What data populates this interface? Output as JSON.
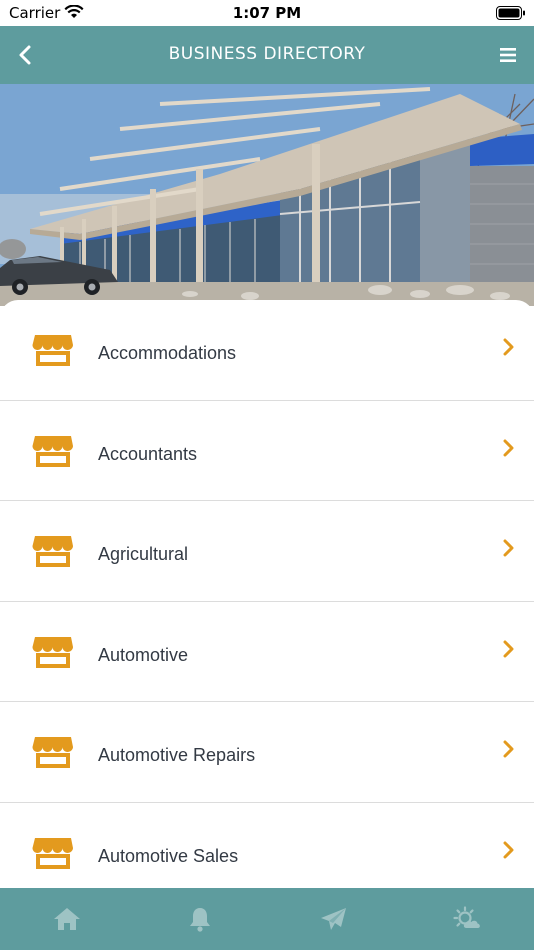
{
  "status_bar": {
    "carrier": "Carrier",
    "time": "1:07 PM",
    "icons": [
      "wifi-icon",
      "battery-icon"
    ]
  },
  "header": {
    "title": "BUSINESS DIRECTORY",
    "back_icon": "chevron-left-icon",
    "menu_icon": "hamburger-menu-icon"
  },
  "hero": {
    "image": "building-exterior-photo"
  },
  "categories": [
    {
      "label": "Accommodations"
    },
    {
      "label": "Accountants"
    },
    {
      "label": "Agricultural"
    },
    {
      "label": "Automotive"
    },
    {
      "label": "Automotive Repairs"
    },
    {
      "label": "Automotive Sales"
    }
  ],
  "tab_bar": {
    "tabs": [
      "home-icon",
      "bell-icon",
      "paper-plane-icon",
      "weather-icon"
    ]
  },
  "colors": {
    "header_teal": "#5e9c9e",
    "accent_orange": "#e39a1e",
    "text_dark": "#333a44"
  }
}
